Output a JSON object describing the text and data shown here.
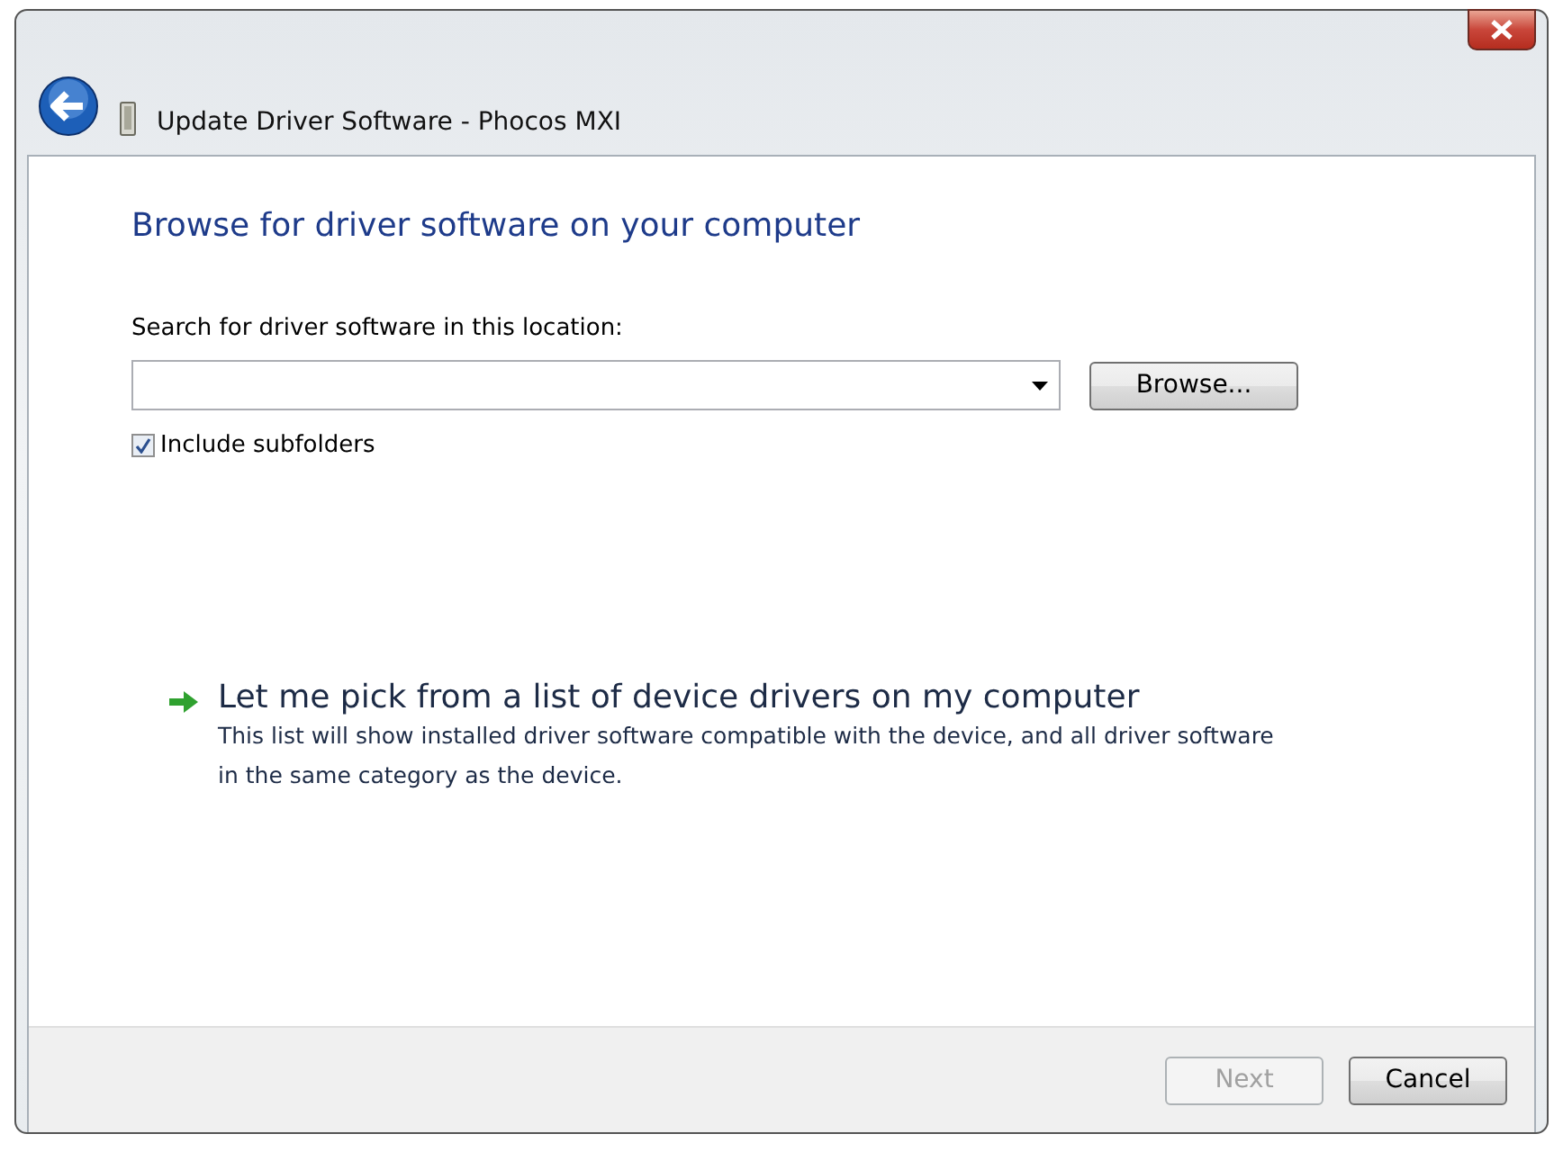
{
  "window": {
    "title": "Update Driver Software - Phocos MXI"
  },
  "heading": "Browse for driver software on your computer",
  "location": {
    "label": "Search for driver software in this location:"
  },
  "browse_button": "Browse...",
  "include_subfolders": {
    "label": "Include subfolders",
    "checked": true
  },
  "option": {
    "title": "Let me pick from a list of device drivers on my computer",
    "description": "This list will show installed driver software compatible with the device, and all driver software in the same category as the device."
  },
  "buttons": [
    {
      "label": "Next",
      "disabled": true
    },
    {
      "label": "Cancel",
      "disabled": false
    }
  ]
}
